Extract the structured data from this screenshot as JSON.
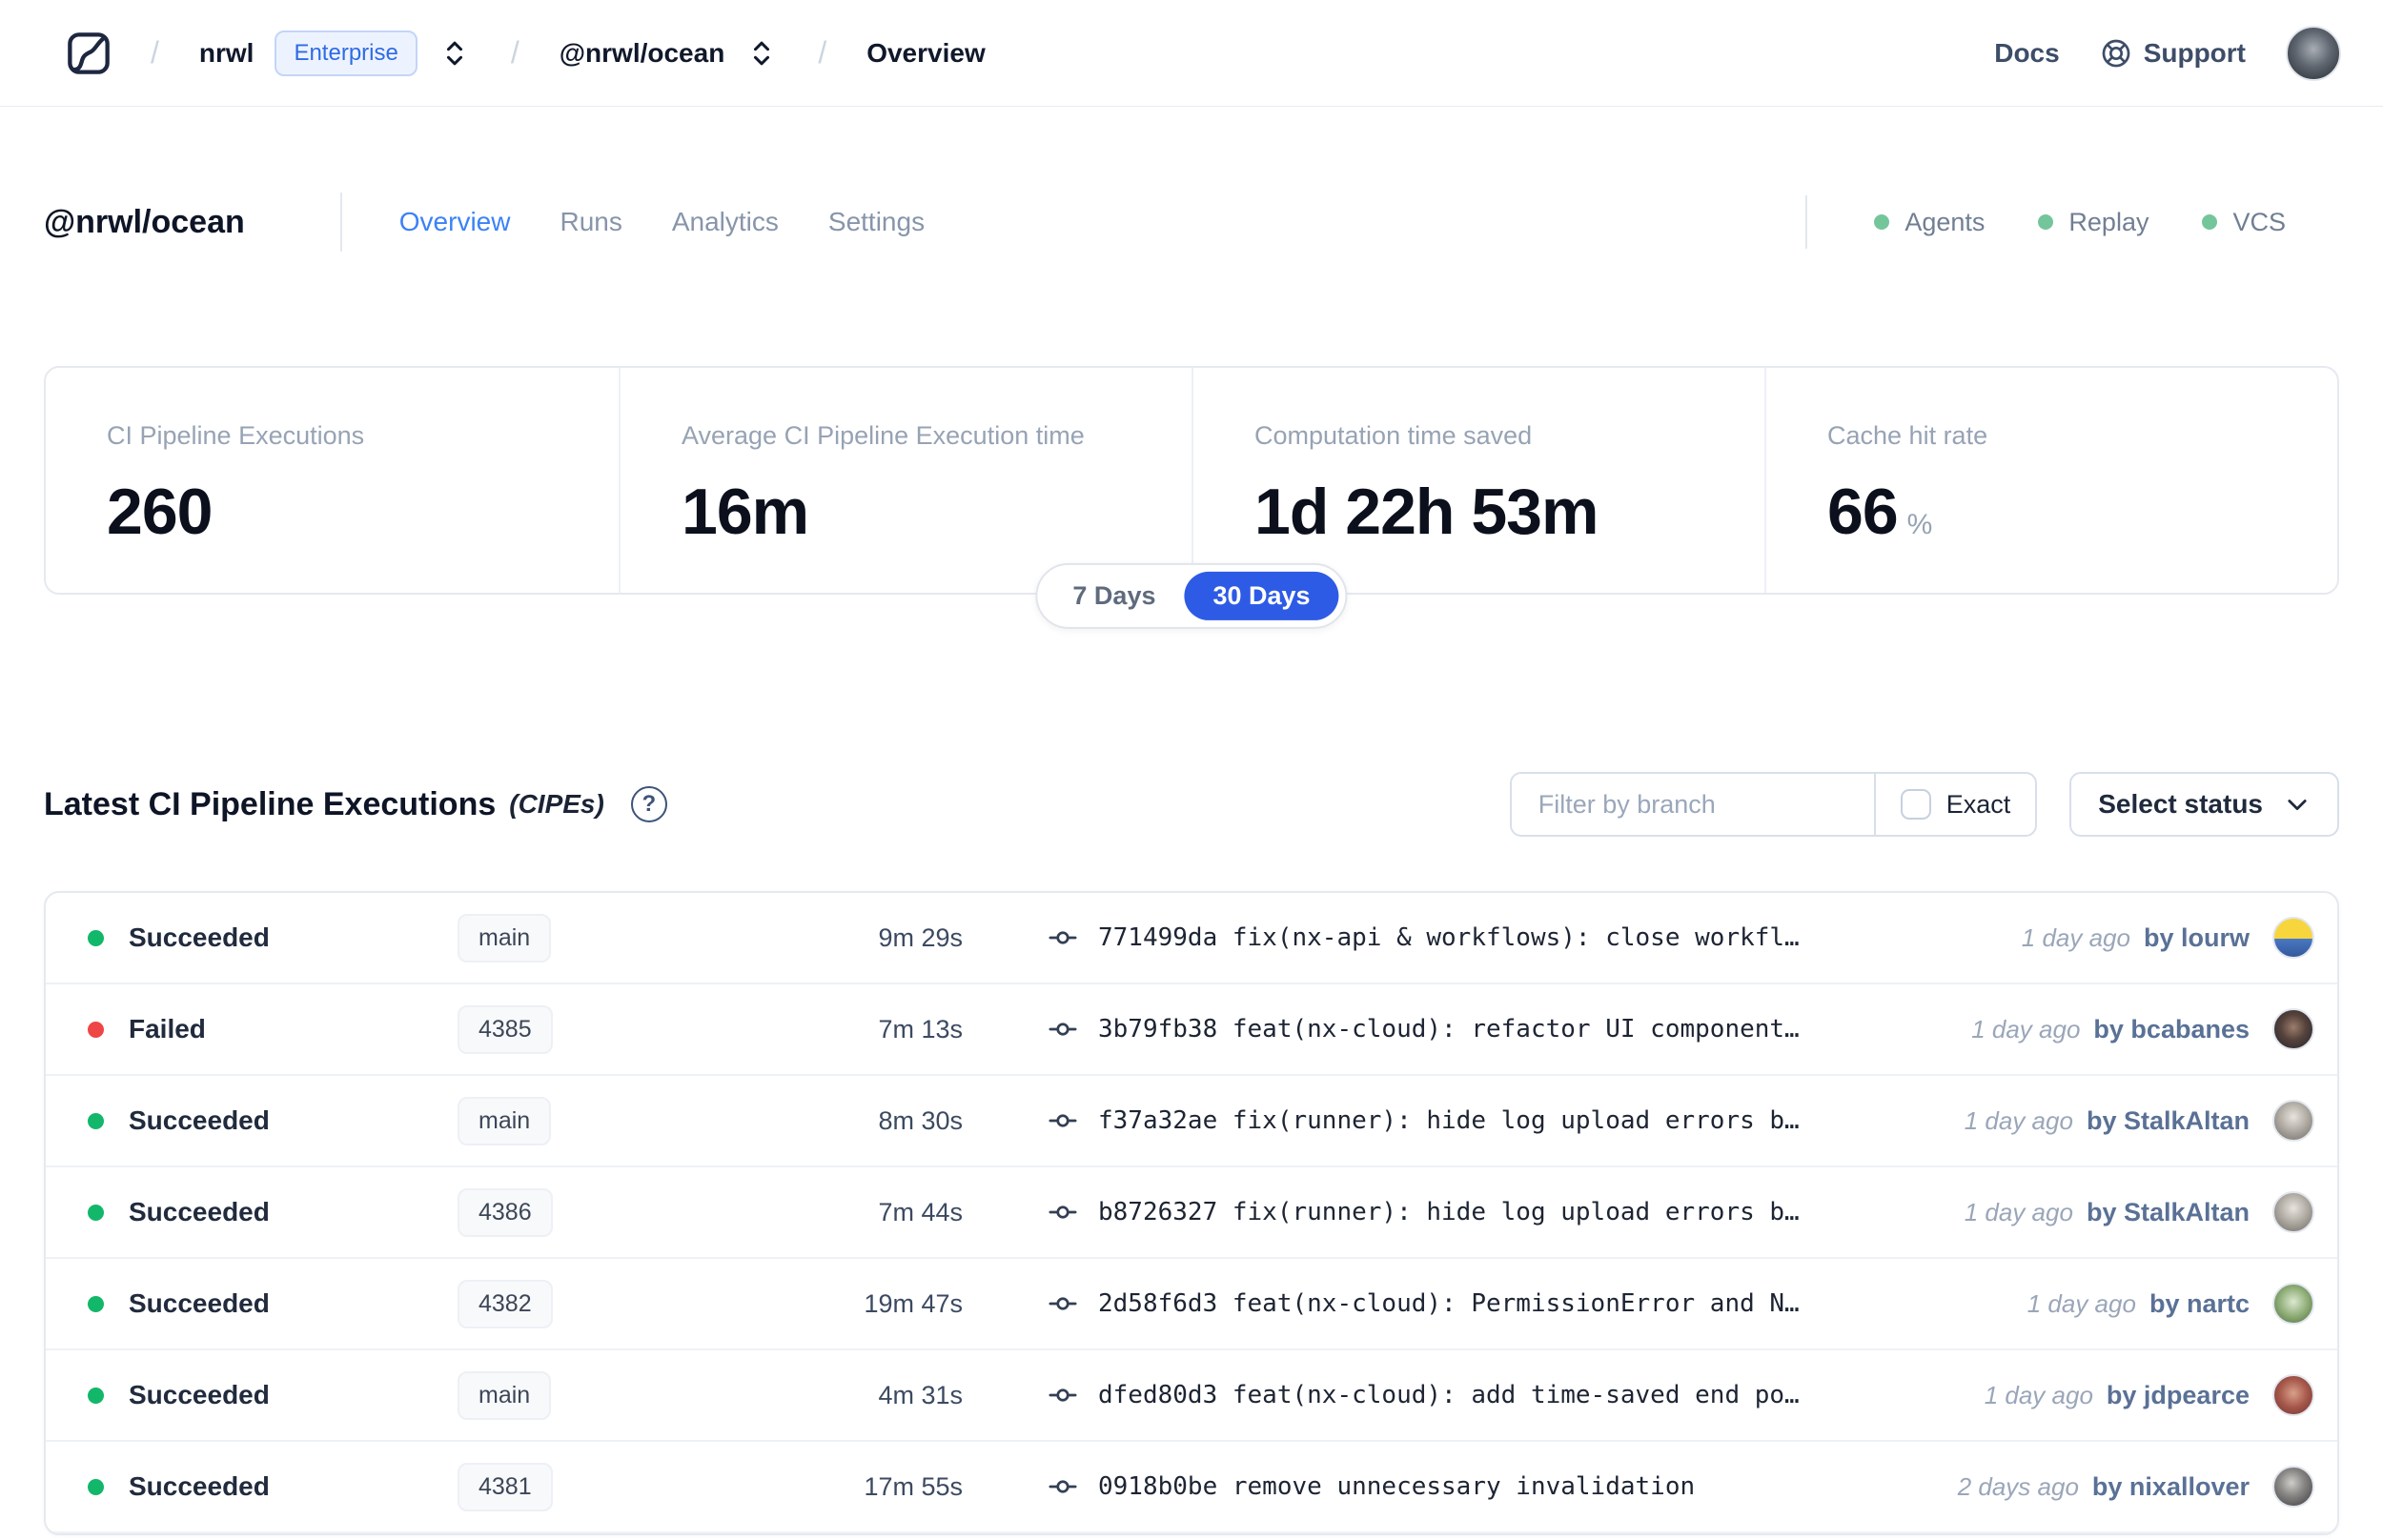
{
  "topbar": {
    "breadcrumb": {
      "separator": "/",
      "org": "nrwl",
      "org_badge": "Enterprise",
      "workspace": "@nrwl/ocean",
      "page": "Overview"
    },
    "links": {
      "docs": "Docs",
      "support": "Support"
    },
    "user_avatar_bg": "radial-gradient(circle at 50% 42%, #a9aeb5 0%, #5f666f 45%, #262a31 100%)"
  },
  "page_header": {
    "title": "@nrwl/ocean",
    "tabs": [
      {
        "label": "Overview",
        "active": true
      },
      {
        "label": "Runs",
        "active": false
      },
      {
        "label": "Analytics",
        "active": false
      },
      {
        "label": "Settings",
        "active": false
      }
    ],
    "features": [
      {
        "label": "Agents"
      },
      {
        "label": "Replay"
      },
      {
        "label": "VCS"
      }
    ]
  },
  "stats": {
    "cards": [
      {
        "label": "CI Pipeline Executions",
        "value": "260",
        "unit": ""
      },
      {
        "label": "Average CI Pipeline Execution time",
        "value": "16m",
        "unit": ""
      },
      {
        "label": "Computation time saved",
        "value": "1d 22h 53m",
        "unit": ""
      },
      {
        "label": "Cache hit rate",
        "value": "66",
        "unit": "%"
      }
    ]
  },
  "range_toggle": {
    "options": [
      {
        "label": "7 Days",
        "active": false
      },
      {
        "label": "30 Days",
        "active": true
      }
    ]
  },
  "cipe": {
    "title": "Latest CI Pipeline Executions",
    "title_suffix": "(CIPEs)",
    "help_icon": "?",
    "filter": {
      "placeholder": "Filter by branch",
      "exact_label": "Exact",
      "exact_checked": false,
      "status_label": "Select status"
    },
    "rows": [
      {
        "status": "Succeeded",
        "branch": "main",
        "duration": "9m 29s",
        "commit": "771499da fix(nx-api & workflows): close workfl…",
        "time": "1 day ago",
        "author": "by lourw",
        "avatar_bg": "linear-gradient(180deg, #f7d53d 0%, #f7d53d 52%, #4a79c4 52%, #33589c 100%)"
      },
      {
        "status": "Failed",
        "branch": "4385",
        "duration": "7m 13s",
        "commit": "3b79fb38 feat(nx-cloud): refactor UI component…",
        "time": "1 day ago",
        "author": "by bcabanes",
        "avatar_bg": "radial-gradient(circle at 50% 45%, #9c7d6b 0%, #55423c 45%, #23252b 100%)"
      },
      {
        "status": "Succeeded",
        "branch": "main",
        "duration": "8m 30s",
        "commit": "f37a32ae fix(runner): hide log upload errors b…",
        "time": "1 day ago",
        "author": "by StalkAltan",
        "avatar_bg": "radial-gradient(circle at 50% 40%, #e8e4de 0%, #b8b4ac 40%, #6e6962 100%)"
      },
      {
        "status": "Succeeded",
        "branch": "4386",
        "duration": "7m 44s",
        "commit": "b8726327 fix(runner): hide log upload errors b…",
        "time": "1 day ago",
        "author": "by StalkAltan",
        "avatar_bg": "radial-gradient(circle at 50% 40%, #e8e4de 0%, #b8b4ac 40%, #6e6962 100%)"
      },
      {
        "status": "Succeeded",
        "branch": "4382",
        "duration": "19m 47s",
        "commit": "2d58f6d3 feat(nx-cloud): PermissionError and N…",
        "time": "1 day ago",
        "author": "by nartc",
        "avatar_bg": "radial-gradient(circle at 50% 45%, #dce8d2 0%, #8fae77 50%, #4e6b42 100%)"
      },
      {
        "status": "Succeeded",
        "branch": "main",
        "duration": "4m 31s",
        "commit": "dfed80d3 feat(nx-cloud): add time-saved end po…",
        "time": "1 day ago",
        "author": "by jdpearce",
        "avatar_bg": "radial-gradient(circle at 50% 45%, #d9a08a 0%, #a5574a 50%, #6e3230 100%)"
      },
      {
        "status": "Succeeded",
        "branch": "4381",
        "duration": "17m 55s",
        "commit": "0918b0be remove unnecessary invalidation",
        "time": "2 days ago",
        "author": "by nixallover",
        "avatar_bg": "radial-gradient(circle at 45% 40%, #cfcdc9 0%, #8a8886 40%, #3a393c 100%)"
      }
    ]
  },
  "colors": {
    "tab_active_blue": "#3b82f6",
    "toggle_active_blue": "#2e5be5",
    "badge_blue": "#2e6be6",
    "success_green": "#12b76a",
    "failed_red": "#ee4545",
    "feature_dot_green": "#74c69a"
  }
}
